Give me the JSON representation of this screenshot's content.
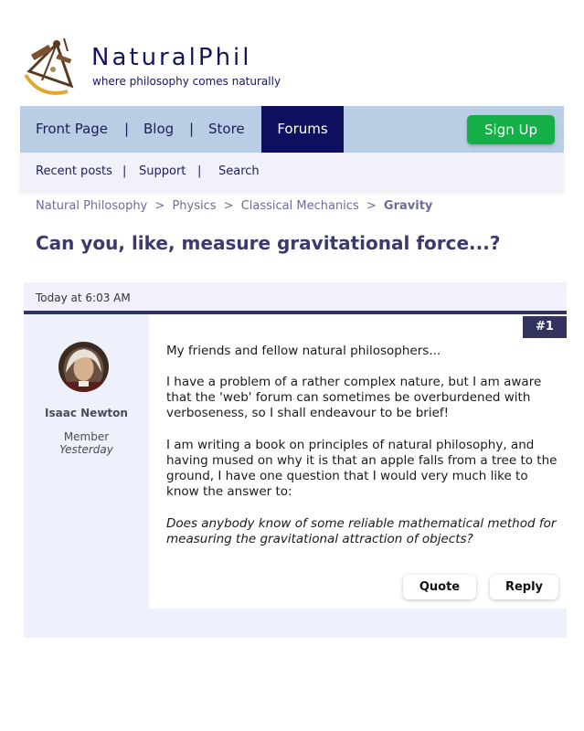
{
  "logo": {
    "brand": "NaturalPhil",
    "tagline": "where philosophy comes naturally"
  },
  "nav": {
    "items": [
      "Front Page",
      "Blog",
      "Store",
      "Forums"
    ],
    "separator": "|",
    "signup": "Sign Up",
    "active": "Forums"
  },
  "subnav": {
    "items": [
      "Recent posts",
      "Support",
      "Search"
    ],
    "separator": "|"
  },
  "breadcrumb": {
    "items": [
      "Natural Philosophy",
      "Physics",
      "Classical Mechanics",
      "Gravity"
    ],
    "separator": ">"
  },
  "thread": {
    "title": "Can you, like, measure gravitational force...?"
  },
  "post": {
    "date": "Today at 6:03 AM",
    "number": "#1",
    "author": {
      "name": "Isaac Newton",
      "role": "Member",
      "last_seen": "Yesterday"
    },
    "paragraphs": [
      "My friends and fellow natural philosophers...",
      "I have a problem of a rather complex nature, but I am aware that the 'web' forum can sometimes be overburdened with verboseness, so I shall endeavour to be brief!",
      "I am writing a book on principles of natural philosophy, and having mused on why it is that an apple falls from a tree to the ground, I have one question that I would very much like to know the answer to:",
      "Does anybody know of some reliable mathematical method for measuring the gravitational attraction of objects?"
    ],
    "actions": {
      "quote": "Quote",
      "reply": "Reply"
    }
  },
  "colors": {
    "nav_bg": "#b9cde4",
    "active_tab": "#0f0f60",
    "signup": "#14b047",
    "accent": "#33335f"
  }
}
